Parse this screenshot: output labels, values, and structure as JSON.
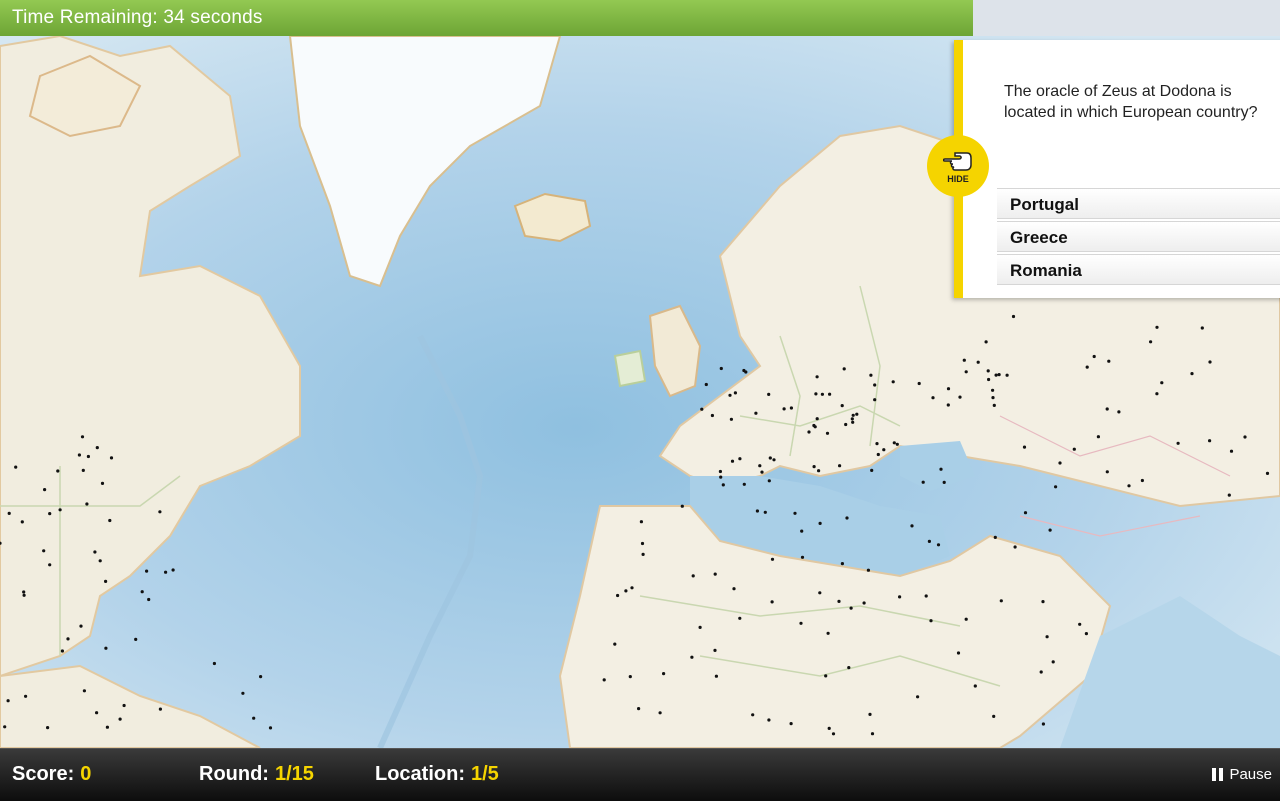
{
  "timer": {
    "text": "Time Remaining: 34 seconds",
    "progress": 0.76
  },
  "question": {
    "text": "The oracle of Zeus at Dodona is located in which European country?",
    "hide_label": "HIDE",
    "answers": [
      "Portugal",
      "Greece",
      "Romania"
    ]
  },
  "status": {
    "score_label": "Score:",
    "score_value": "0",
    "round_label": "Round:",
    "round_value": "1/15",
    "location_label": "Location:",
    "location_value": "1/5",
    "pause_label": "Pause"
  },
  "colors": {
    "accent": "#f5d400",
    "timer_green": "#7fb642",
    "ocean": "#b8d6ea",
    "land": "#f2efe4"
  },
  "icons": {
    "hide": "pointing-hand-icon",
    "pause": "pause-icon"
  }
}
